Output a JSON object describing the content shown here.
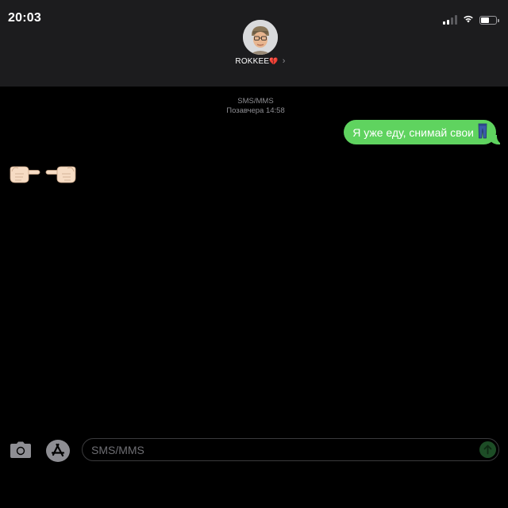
{
  "status_bar": {
    "time": "20:03",
    "signal_level": 2,
    "signal_max": 4,
    "battery_level": 0.55
  },
  "header": {
    "contact_name": "ROKKEE",
    "contact_emoji": "💔",
    "chevron": "›",
    "avatar_icon": "memoji-avatar-icon"
  },
  "conversation": {
    "service": "SMS/MMS",
    "timestamp": "Позавчера 14:58",
    "messages": [
      {
        "direction": "outgoing",
        "text": "Я уже еду, снимай свои",
        "icon": "jeans-icon"
      },
      {
        "direction": "incoming",
        "icons": [
          "pointing-right-hand-icon",
          "pointing-left-hand-icon"
        ]
      }
    ]
  },
  "input_bar": {
    "placeholder": "SMS/MMS",
    "camera_icon": "camera-icon",
    "apps_icon": "app-store-icon",
    "send_icon": "send-arrow-icon"
  },
  "colors": {
    "header_bg": "#1c1c1e",
    "bubble_green": "#5fd35f",
    "send_disabled": "#1d4d26",
    "secondary_text": "#8e8e93"
  }
}
